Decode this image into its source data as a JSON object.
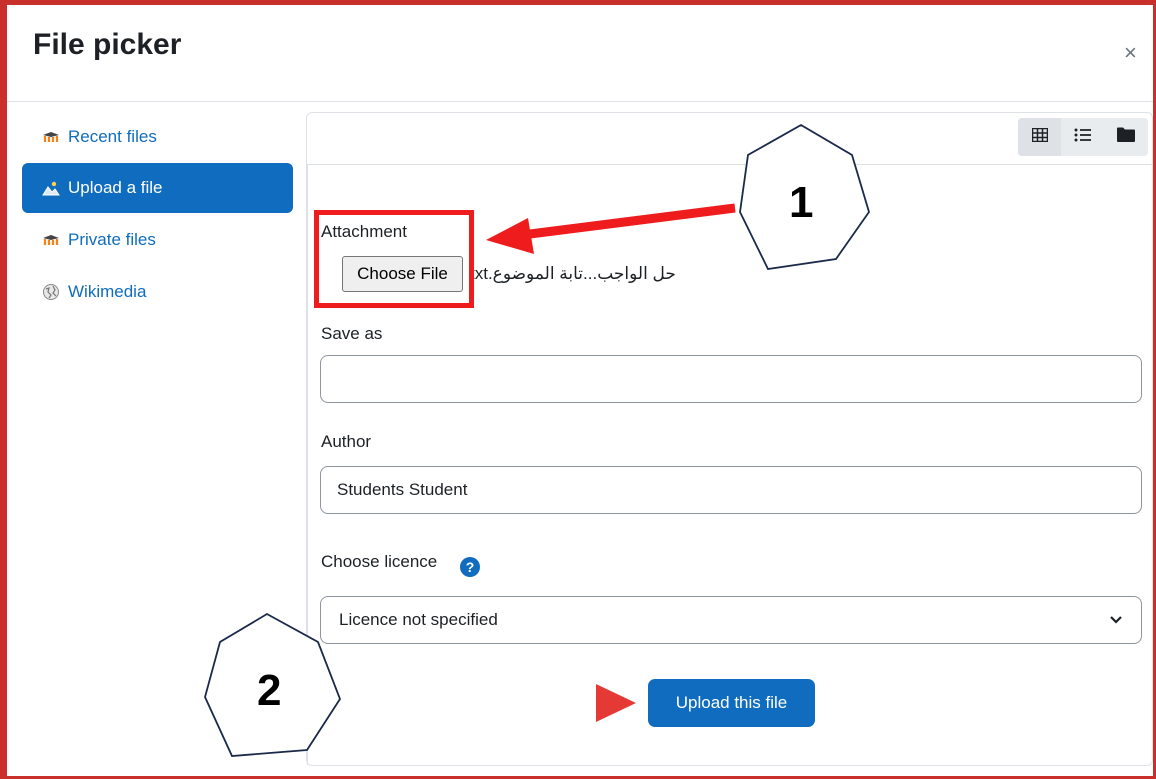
{
  "dialog": {
    "title": "File picker",
    "close_symbol": "×"
  },
  "sidebar": {
    "items": [
      {
        "label": "Recent files",
        "icon": "moodle-hat-icon",
        "active": false
      },
      {
        "label": "Upload a file",
        "icon": "upload-icon",
        "active": true
      },
      {
        "label": "Private files",
        "icon": "moodle-hat-icon",
        "active": false
      },
      {
        "label": "Wikimedia",
        "icon": "wikimedia-globe-icon",
        "active": false
      }
    ]
  },
  "toolbar": {
    "views": [
      {
        "name": "icons-view",
        "icon": "grid-icon",
        "active": true
      },
      {
        "name": "list-view",
        "icon": "list-icon",
        "active": false
      },
      {
        "name": "tree-view",
        "icon": "folder-icon",
        "active": false
      }
    ]
  },
  "form": {
    "attachment_label": "Attachment",
    "choose_file_label": "Choose File",
    "selected_file_name": "txt.حل الواجب...تابة الموضوع",
    "save_as_label": "Save as",
    "save_as_value": "",
    "author_label": "Author",
    "author_value": "Students Student",
    "licence_label": "Choose licence",
    "licence_help_symbol": "?",
    "licence_selected": "Licence not specified",
    "upload_button_label": "Upload this file"
  },
  "annotations": {
    "callout_1": "1",
    "callout_2": "2",
    "arrow_color": "#ee1c1c",
    "highlight_color": "#ee1c1c"
  },
  "colors": {
    "accent": "#0f6cbf",
    "frame": "#c9302c"
  }
}
